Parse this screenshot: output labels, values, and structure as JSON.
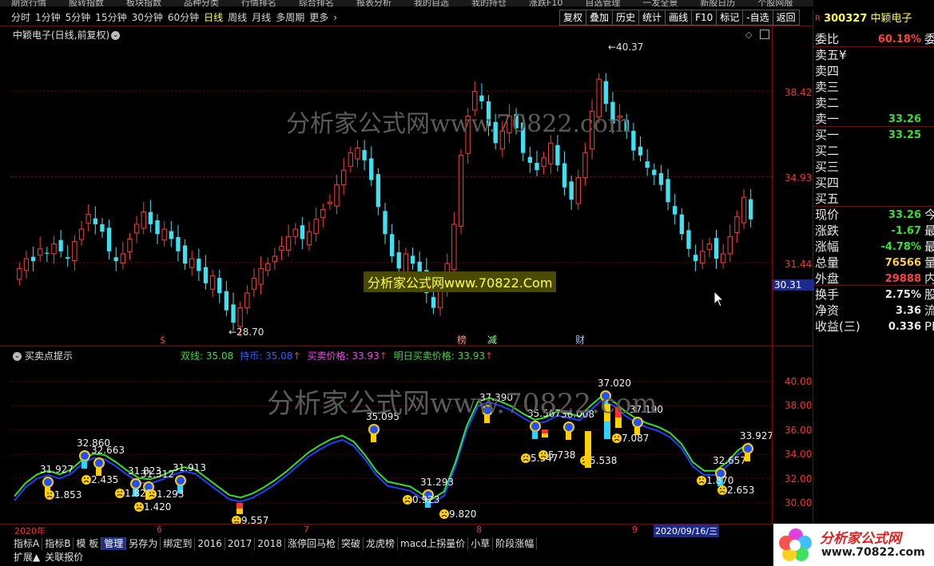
{
  "menu_strip": [
    "期货行情",
    "股转指数",
    "板块指数",
    "品种分类",
    "行情排名",
    "综合排名",
    "报表分析",
    "我的自选",
    "我的持仓",
    "涨跌F10",
    "自选管理",
    "一发全景",
    "新股日历",
    "个股网服"
  ],
  "period_bar": {
    "items": [
      "分时",
      "1分钟",
      "5分钟",
      "15分钟",
      "30分钟",
      "60分钟",
      "日线",
      "周线",
      "月线",
      "多周期",
      "更多"
    ],
    "active": "日线",
    "more_icon": "chevron-right-icon"
  },
  "toolbar_right": [
    "复权",
    "叠加",
    "历史",
    "统计",
    "画线",
    "F10",
    "标记",
    "-自选",
    "返回"
  ],
  "kline": {
    "title": "中颖电子(日线,前复权)",
    "price_labels": [
      "38.42",
      "34.93",
      "31.44"
    ],
    "current_price_label": "30.31",
    "high_annotation": "40.37",
    "low_annotation": "28.70",
    "markers": [
      "$",
      "榜",
      "减",
      "财"
    ],
    "watermark": "分析家公式网www.70822.com",
    "watermark_box": "分析家公式网www.70822.Com"
  },
  "subchart": {
    "title": "买卖点提示",
    "legend": [
      {
        "text": "双线: 35.08",
        "color": "#36e036"
      },
      {
        "text": "持币: 35.08",
        "color": "#3060ff",
        "arrow": "↑"
      },
      {
        "text": "买卖价格: 33.93",
        "color": "#ff44ff",
        "arrow": "↑"
      },
      {
        "text": "明日买卖价格: 33.93",
        "color": "#36e036",
        "arrow": "↑"
      }
    ],
    "axis_labels": [
      "40.00",
      "38.00",
      "36.00",
      "34.00",
      "32.00",
      "30.00"
    ],
    "peak_labels": [
      "31.927",
      "32.860",
      "32.663",
      "31.823",
      "31.312",
      "31.913",
      "35.095",
      "31.293",
      "37.390",
      "35.567",
      "36.008",
      "37.020",
      "37.190",
      "32.657",
      "33.927"
    ],
    "trough_labels": [
      "1.853",
      "2.435",
      "1.828",
      "1.420",
      "1.293",
      "9.557",
      "0.923",
      "9.820",
      "5.547",
      "5.738",
      "5.538",
      "7.087",
      "1.870",
      "2.653"
    ],
    "watermark": "分析家公式网www.70822.com"
  },
  "quote": {
    "code_marker": "R",
    "code": "300327",
    "name": "中颖电子",
    "rows": [
      {
        "label": "委比",
        "value": "60.18%",
        "tail": "委差",
        "color": "#ff4040"
      },
      {
        "label": "卖五",
        "value": "",
        "tail": "",
        "color": "#e8e8e8",
        "suffix": "¥"
      },
      {
        "label": "卖四",
        "value": "",
        "tail": "",
        "color": "#e8e8e8"
      },
      {
        "label": "卖三",
        "value": "",
        "tail": "",
        "color": "#e8e8e8"
      },
      {
        "label": "卖二",
        "value": "",
        "tail": "",
        "color": "#e8e8e8"
      },
      {
        "label": "卖一",
        "value": "33.26",
        "tail": "",
        "color": "#36e036"
      },
      {
        "label": "买一",
        "value": "33.25",
        "tail": "",
        "color": "#36e036"
      },
      {
        "label": "买二",
        "value": "",
        "tail": "",
        "color": "#e8e8e8"
      },
      {
        "label": "买三",
        "value": "",
        "tail": "",
        "color": "#e8e8e8"
      },
      {
        "label": "买四",
        "value": "",
        "tail": "",
        "color": "#e8e8e8"
      },
      {
        "label": "买五",
        "value": "",
        "tail": "",
        "color": "#e8e8e8"
      },
      {
        "label": "现价",
        "value": "33.26",
        "tail": "今开",
        "color": "#36e036"
      },
      {
        "label": "涨跌",
        "value": "-1.67",
        "tail": "最高",
        "color": "#36e036"
      },
      {
        "label": "涨幅",
        "value": "-4.78%",
        "tail": "最低",
        "color": "#36e036"
      },
      {
        "label": "总量",
        "value": "76566",
        "tail": "量比",
        "color": "#ffd040"
      },
      {
        "label": "外盘",
        "value": "29888",
        "tail": "内盘",
        "color": "#ff4040"
      },
      {
        "label": "换手",
        "value": "2.75%",
        "tail": "股本",
        "color": "#e8e8e8"
      },
      {
        "label": "净资",
        "value": "3.36",
        "tail": "流通",
        "color": "#e8e8e8"
      },
      {
        "label": "收益(三)",
        "value": "0.336",
        "tail": "PE(动)",
        "color": "#e8e8e8"
      }
    ]
  },
  "date_axis": [
    {
      "label": "2020年",
      "color": "#ff3030"
    },
    {
      "label": "6",
      "color": "#ff3030"
    },
    {
      "label": "7",
      "color": "#ff3030"
    },
    {
      "label": "8",
      "color": "#ff3030"
    },
    {
      "label": "9",
      "color": "#ff3030"
    },
    {
      "label": "2020/09/16/三",
      "color": "#ffffff"
    }
  ],
  "tabs_row1": [
    "指标A",
    "指标B",
    "模 板",
    "管理",
    "另存为",
    "绑定到",
    "2016",
    "2017",
    "2018",
    "涨停回马枪",
    "突破",
    "龙虎榜",
    "macd上拐量价",
    "小草",
    "阶段涨幅"
  ],
  "tabs_row1_active": "管理",
  "tabs_row2": [
    "扩展▲",
    "关联报价"
  ],
  "logo_text": "分析家公式网",
  "logo_url": "www.70822.com"
}
